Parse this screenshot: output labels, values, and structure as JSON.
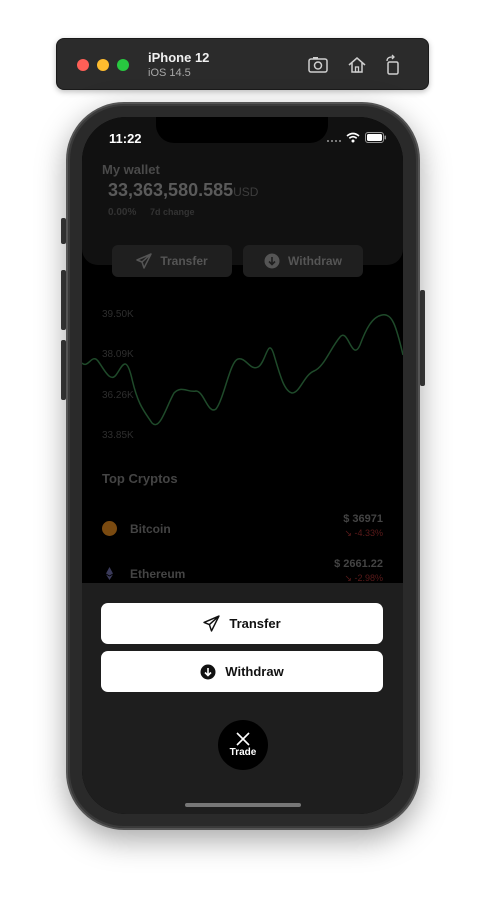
{
  "simulator": {
    "device_name": "iPhone 12",
    "os_version": "iOS 14.5",
    "icons": [
      "screenshot-icon",
      "home-icon",
      "rotate-icon"
    ]
  },
  "status_bar": {
    "time": "11:22"
  },
  "wallet": {
    "label": "My wallet",
    "balance": "33,363,580.585",
    "currency": "USD",
    "change": "0.00%",
    "change_label": "7d change"
  },
  "background_actions": {
    "transfer_label": "Transfer",
    "withdraw_label": "Withdraw"
  },
  "chart": {
    "y_ticks": [
      "39.50K",
      "38.09K",
      "36.26K",
      "33.85K"
    ],
    "line_color": "#1f4a2a"
  },
  "top_cryptos": {
    "title": "Top Cryptos",
    "items": [
      {
        "name": "Bitcoin",
        "price": "$ 36971",
        "change": "↘ -4.33%",
        "icon": "bitcoin-icon",
        "color": "#7a4a10"
      },
      {
        "name": "Ethereum",
        "price": "$ 2661.22",
        "change": "↘ -2.98%",
        "icon": "ethereum-icon",
        "color": "#3a3a5a"
      }
    ]
  },
  "action_sheet": {
    "transfer_label": "Transfer",
    "withdraw_label": "Withdraw",
    "trade_label": "Trade"
  }
}
